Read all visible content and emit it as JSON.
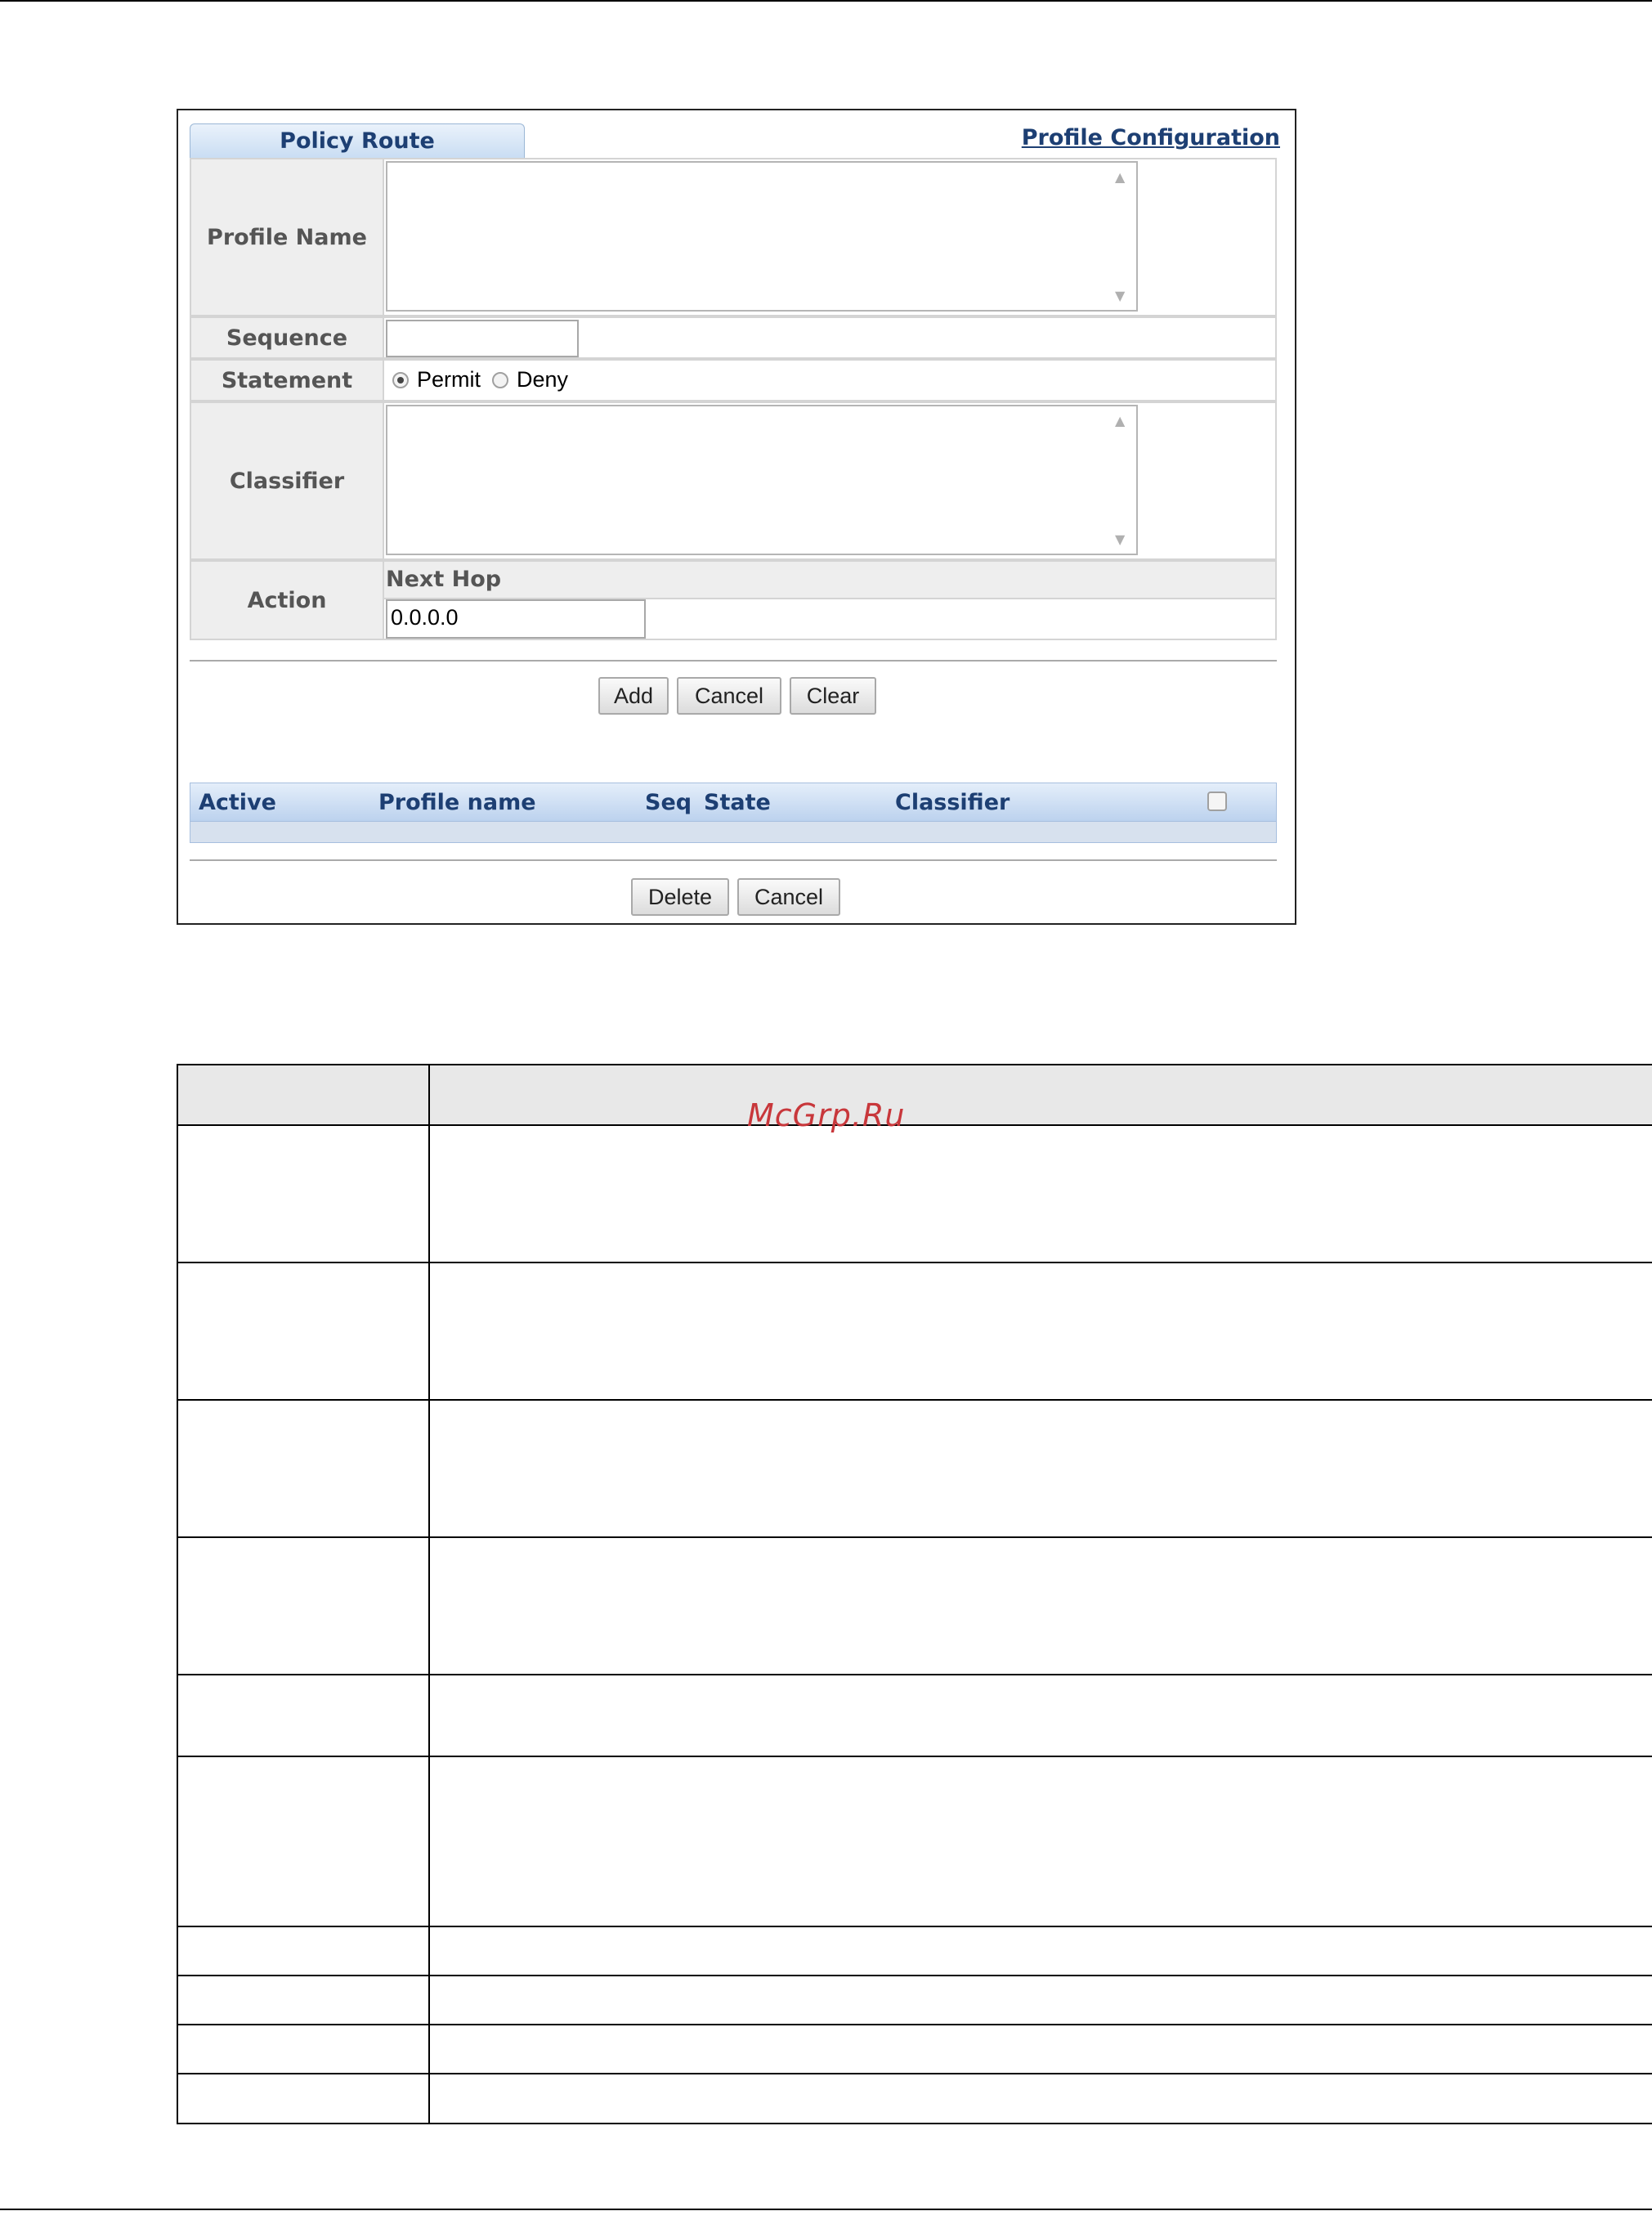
{
  "panel": {
    "tab_label": "Policy Route",
    "profile_config_link": "Profile Configuration",
    "form": {
      "profile_name_label": "Profile Name",
      "profile_name_value": "",
      "sequence_label": "Sequence",
      "sequence_value": "",
      "statement_label": "Statement",
      "statement_options": [
        "Permit",
        "Deny"
      ],
      "statement_selected": "Permit",
      "classifier_label": "Classifier",
      "classifier_value": "",
      "action_label": "Action",
      "next_hop_label": "Next Hop",
      "next_hop_value": "0.0.0.0"
    },
    "form_buttons": {
      "add": "Add",
      "cancel": "Cancel",
      "clear": "Clear"
    },
    "list": {
      "columns": [
        "Active",
        "Profile name",
        "Seq",
        "State",
        "Classifier"
      ]
    },
    "list_buttons": {
      "delete": "Delete",
      "cancel": "Cancel"
    }
  },
  "watermark": "McGrp.Ru",
  "icons": [
    "scroll-up-icon",
    "scroll-down-icon"
  ]
}
